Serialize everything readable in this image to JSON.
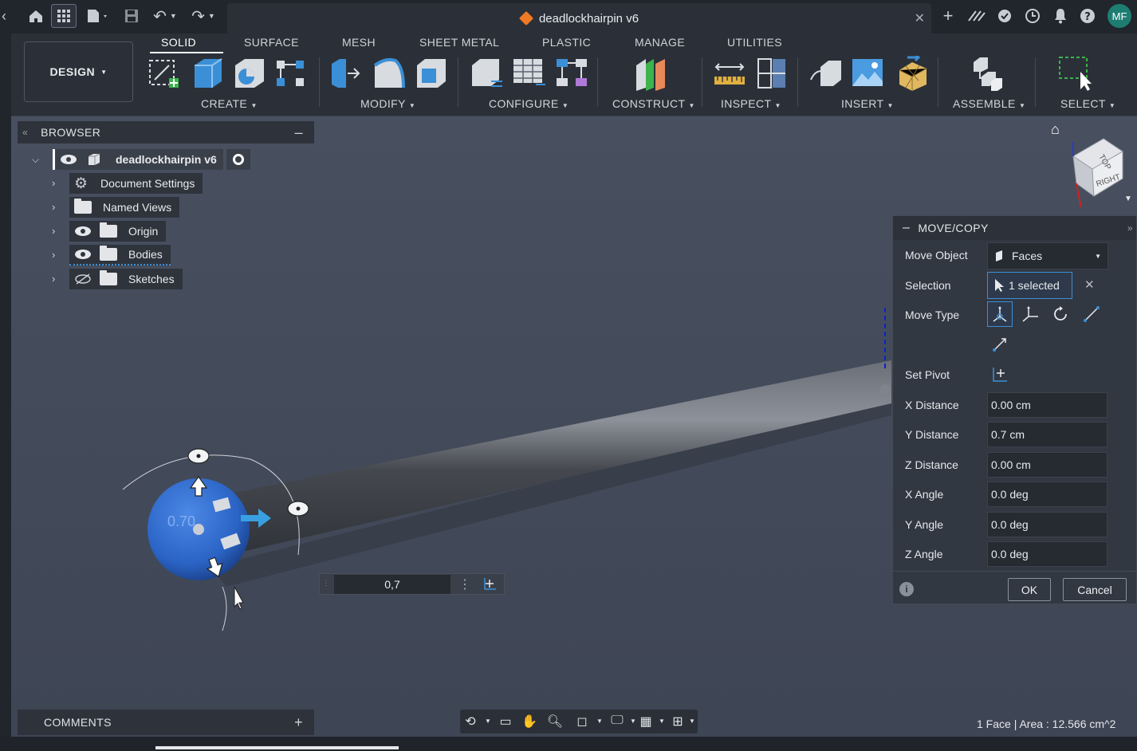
{
  "titlebar": {
    "document_title": "deadlockhairpin v6",
    "avatar_initials": "MF"
  },
  "toolbar": {
    "workspace": "DESIGN",
    "tabs": [
      "SOLID",
      "SURFACE",
      "MESH",
      "SHEET METAL",
      "PLASTIC",
      "MANAGE",
      "UTILITIES"
    ],
    "active_tab": "SOLID",
    "groups": [
      "CREATE",
      "MODIFY",
      "CONFIGURE",
      "CONSTRUCT",
      "INSPECT",
      "INSERT",
      "ASSEMBLE",
      "SELECT"
    ]
  },
  "browser": {
    "title": "BROWSER",
    "root": "deadlockhairpin v6",
    "items": [
      "Document Settings",
      "Named Views",
      "Origin",
      "Bodies",
      "Sketches"
    ]
  },
  "viewcube": {
    "top": "TOP",
    "right": "RIGHT"
  },
  "dialog": {
    "title": "MOVE/COPY",
    "move_object_label": "Move Object",
    "move_object_value": "Faces",
    "selection_label": "Selection",
    "selection_value": "1 selected",
    "move_type_label": "Move Type",
    "set_pivot_label": "Set Pivot",
    "x_distance_label": "X Distance",
    "x_distance": "0.00 cm",
    "y_distance_label": "Y Distance",
    "y_distance": "0.7 cm",
    "z_distance_label": "Z Distance",
    "z_distance": "0.00 cm",
    "x_angle_label": "X Angle",
    "x_angle": "0.0 deg",
    "y_angle_label": "Y Angle",
    "y_angle": "0.0 deg",
    "z_angle_label": "Z Angle",
    "z_angle": "0.0 deg",
    "ok": "OK",
    "cancel": "Cancel"
  },
  "manipulator": {
    "value_input": "0,7",
    "sphere_label": "0.70"
  },
  "comments": {
    "title": "COMMENTS"
  },
  "status": {
    "text": "1 Face | Area : 12.566 cm^2"
  },
  "colors": {
    "accent": "#3b8fd6",
    "manipulator_blue": "#2a63c4",
    "avatar": "#1e7d73",
    "doc_icon": "#f07a24"
  }
}
